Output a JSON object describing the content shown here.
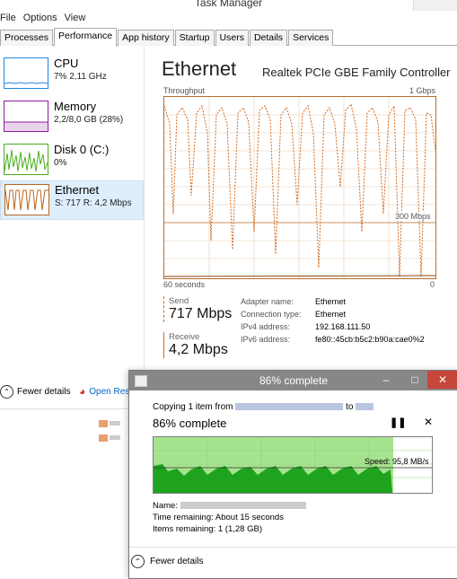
{
  "window": {
    "title": "Task Manager"
  },
  "menu": [
    "File",
    "Options",
    "View"
  ],
  "tabs": [
    "Processes",
    "Performance",
    "App history",
    "Startup",
    "Users",
    "Details",
    "Services"
  ],
  "sidebar": {
    "items": [
      {
        "name": "CPU",
        "sub": "7% 2,11 GHz",
        "color": "#1e88e5"
      },
      {
        "name": "Memory",
        "sub": "2,2/8,0 GB (28%)",
        "color": "#8b1c9c"
      },
      {
        "name": "Disk 0 (C:)",
        "sub": "0%",
        "color": "#4caf1f"
      },
      {
        "name": "Ethernet",
        "sub": "S: 717 R: 4,2 Mbps",
        "color": "#b8661f"
      }
    ]
  },
  "main": {
    "title": "Ethernet",
    "adapter": "Realtek PCIe GBE Family Controller",
    "throughput_label": "Throughput",
    "max_label": "1 Gbps",
    "mid_label": "300 Mbps",
    "time_label": "60 seconds",
    "zero_label": "0",
    "send": {
      "label": "Send",
      "value": "717 Mbps"
    },
    "receive": {
      "label": "Receive",
      "value": "4,2 Mbps"
    },
    "info": [
      {
        "k": "Adapter name:",
        "v": "Ethernet"
      },
      {
        "k": "Connection type:",
        "v": "Ethernet"
      },
      {
        "k": "IPv4 address:",
        "v": "192.168.111.50"
      },
      {
        "k": "IPv6 address:",
        "v": "fe80::45cb:b5c2:b90a:cae0%2"
      }
    ],
    "fewer_details": "Fewer details",
    "open_resource": "Open Res"
  },
  "dialog": {
    "title": "86% complete",
    "copy_prefix": "Copying 1 item from",
    "copy_to": "to",
    "percent": "86% complete",
    "speed": "Speed: 95,8 MB/s",
    "name_label": "Name:",
    "time_label": "Time remaining:",
    "time_value": "About 15 seconds",
    "items_label": "Items remaining:",
    "items_value": "1 (1,28 GB)",
    "fewer_details": "Fewer details",
    "progress": 0.86
  }
}
